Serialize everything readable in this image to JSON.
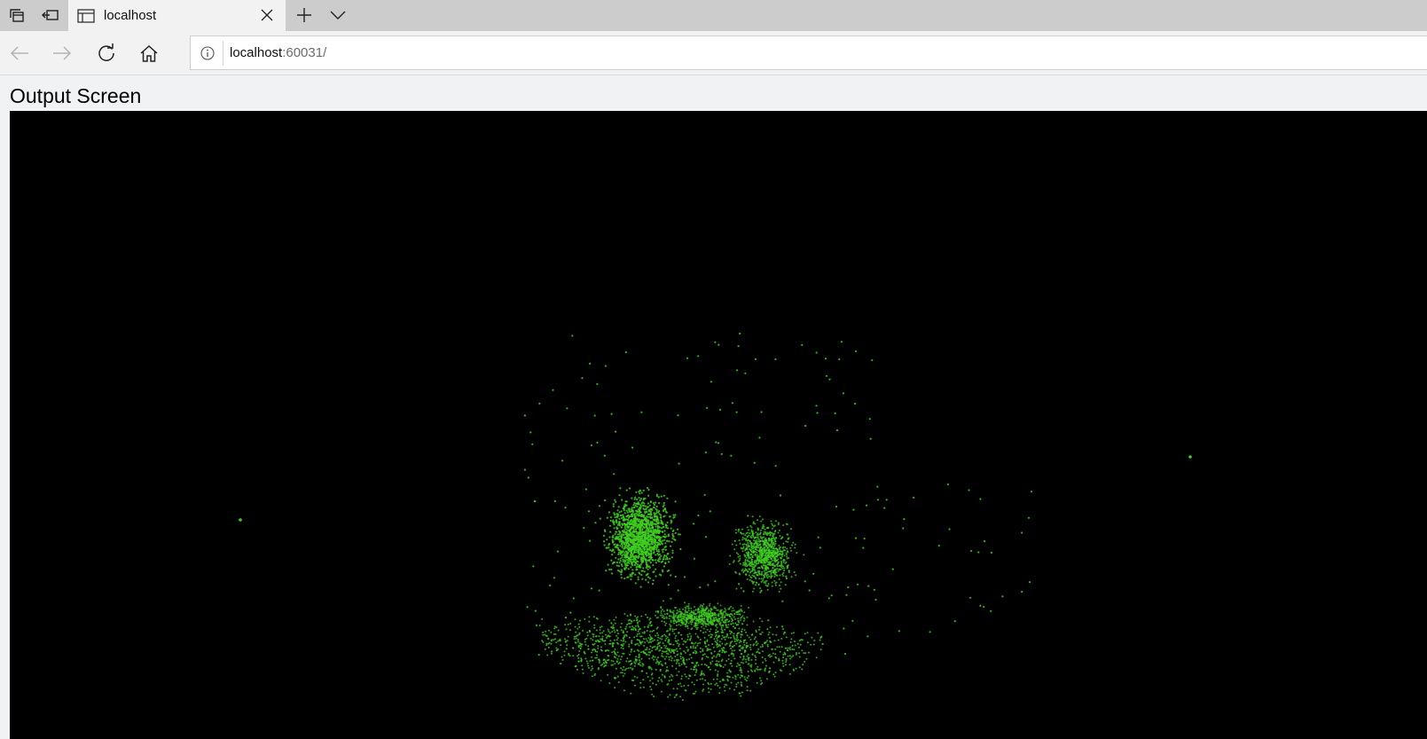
{
  "browser": {
    "tab": {
      "title": "localhost"
    },
    "address": {
      "host": "localhost",
      "port": ":60031/"
    }
  },
  "page": {
    "title": "Output Screen"
  },
  "point_cloud": {
    "background_color": "#000000",
    "point_color": "#3fcf1f"
  }
}
